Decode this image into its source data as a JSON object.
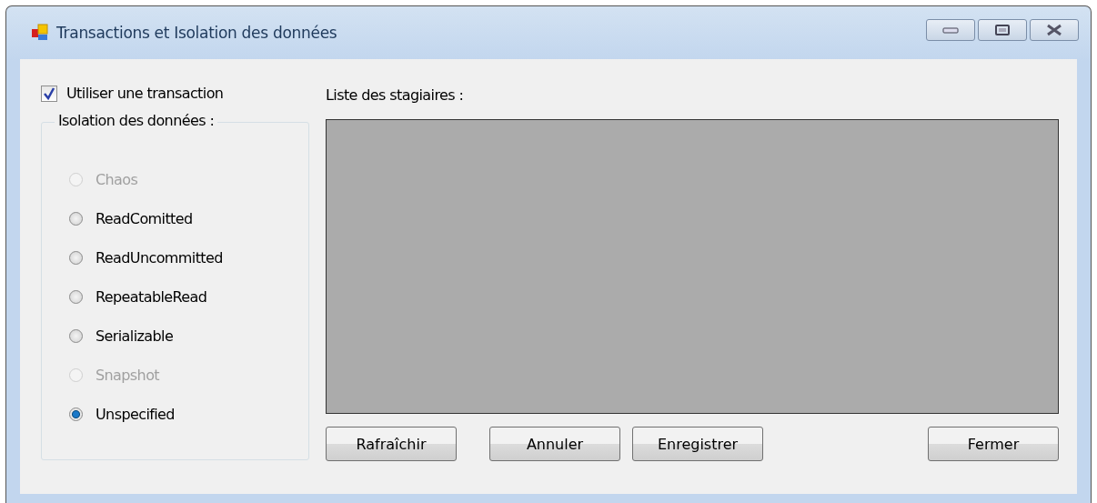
{
  "window": {
    "title": "Transactions et Isolation des données"
  },
  "use_transaction": {
    "label": "Utiliser une transaction",
    "checked": true
  },
  "isolation": {
    "title": "Isolation des données :",
    "options": [
      {
        "label": "Chaos",
        "selected": false,
        "disabled": true
      },
      {
        "label": "ReadComitted",
        "selected": false,
        "disabled": false
      },
      {
        "label": "ReadUncommitted",
        "selected": false,
        "disabled": false
      },
      {
        "label": "RepeatableRead",
        "selected": false,
        "disabled": false
      },
      {
        "label": "Serializable",
        "selected": false,
        "disabled": false
      },
      {
        "label": "Snapshot",
        "selected": false,
        "disabled": true
      },
      {
        "label": "Unspecified",
        "selected": true,
        "disabled": false
      }
    ]
  },
  "list": {
    "label": "Liste des stagiaires :"
  },
  "buttons": [
    {
      "label": "Rafraîchir",
      "kind": "left"
    },
    {
      "label": "Annuler",
      "kind": "left"
    },
    {
      "label": "Enregistrer",
      "kind": "left"
    },
    {
      "label": "Fermer",
      "kind": "right"
    }
  ]
}
